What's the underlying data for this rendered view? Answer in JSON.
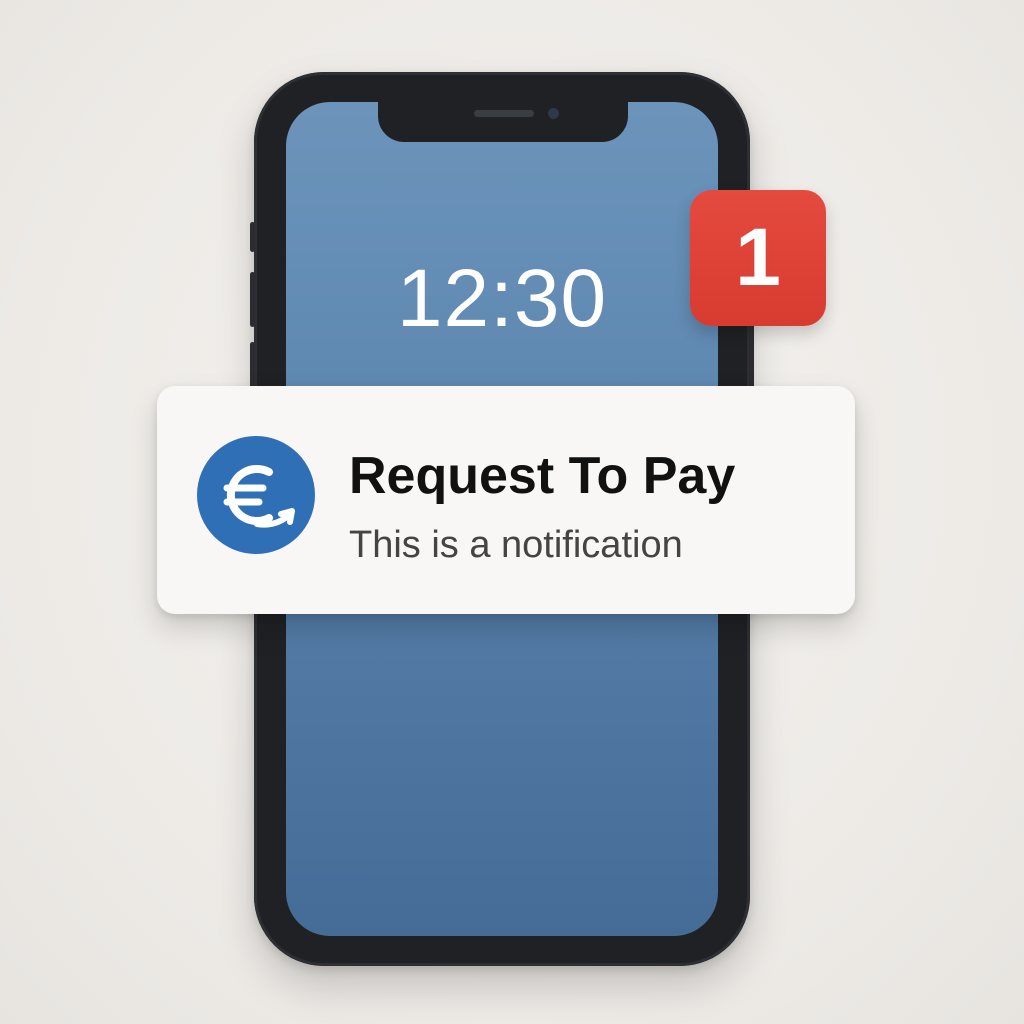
{
  "lock_screen": {
    "time": "12:30"
  },
  "badge": {
    "count": "1",
    "color": "#dc3f34"
  },
  "notification": {
    "title": "Request To Pay",
    "body": "This is a notification",
    "icon": "euro-exchange-icon",
    "icon_color": "#2f6fb5"
  },
  "colors": {
    "wallpaper_top": "#6c94bb",
    "wallpaper_bottom": "#456c97",
    "phone_frame": "#1f2124"
  }
}
